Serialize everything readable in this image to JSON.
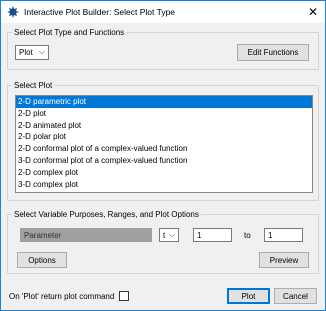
{
  "window": {
    "title": "Interactive Plot Builder: Select Plot Type",
    "close_glyph": "✕"
  },
  "plot_type_group": {
    "legend": "Select Plot Type and Functions",
    "plot_combo_value": "Plot",
    "edit_functions_label": "Edit Functions"
  },
  "select_plot_group": {
    "legend": "Select Plot",
    "items": [
      "2-D parametric plot",
      "2-D plot",
      "2-D animated plot",
      "2-D polar plot",
      "2-D conformal plot of a complex-valued function",
      "3-D conformal plot of a complex-valued function",
      "2-D complex plot",
      "3-D complex plot"
    ],
    "selected_index": 0
  },
  "variable_group": {
    "legend": "Select Variable Purposes, Ranges, and Plot Options",
    "parameter_field": "Parameter",
    "variable_combo_value": "t",
    "range_from": "1",
    "to_label": "to",
    "range_to": "1",
    "options_label": "Options",
    "preview_label": "Preview"
  },
  "footer": {
    "return_command_label": "On 'Plot' return plot command",
    "return_command_checked": false,
    "plot_label": "Plot",
    "cancel_label": "Cancel"
  },
  "colors": {
    "accent": "#0078d7",
    "border": "#1883d7"
  }
}
